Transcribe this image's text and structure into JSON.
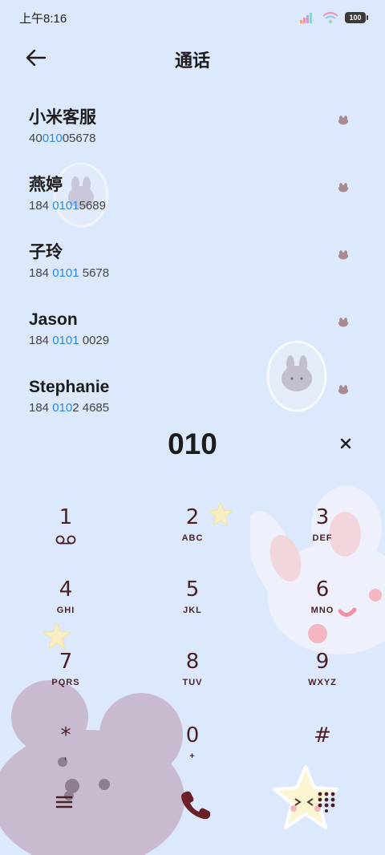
{
  "status_bar": {
    "time": "上午8:16",
    "battery": "100"
  },
  "header": {
    "title": "通话",
    "back_icon": "back-arrow-icon"
  },
  "contacts": [
    {
      "name": "小米客服",
      "number_pre": "40",
      "number_match": "010",
      "number_post": "05678"
    },
    {
      "name": "燕婷",
      "number_pre": "184 ",
      "number_match": "0101",
      "number_post": "5689"
    },
    {
      "name": "子玲",
      "number_pre": "184 ",
      "number_match": "0101",
      "number_post": " 5678"
    },
    {
      "name": "Jason",
      "number_pre": "184 ",
      "number_match": "0101",
      "number_post": " 0029"
    },
    {
      "name": "Stephanie",
      "number_pre": "184 ",
      "number_match": "010",
      "number_post": "2 4685"
    }
  ],
  "dial_input": {
    "value": "010",
    "delete_icon": "close-icon"
  },
  "keypad": [
    {
      "digit": "1",
      "letters": "",
      "icon": "voicemail-icon"
    },
    {
      "digit": "2",
      "letters": "ABC"
    },
    {
      "digit": "3",
      "letters": "DEF"
    },
    {
      "digit": "4",
      "letters": "GHI"
    },
    {
      "digit": "5",
      "letters": "JKL"
    },
    {
      "digit": "6",
      "letters": "MNO"
    },
    {
      "digit": "7",
      "letters": "PQRS"
    },
    {
      "digit": "8",
      "letters": "TUV"
    },
    {
      "digit": "9",
      "letters": "WXYZ"
    },
    {
      "digit": "*",
      "letters": ","
    },
    {
      "digit": "0",
      "letters": "+"
    },
    {
      "digit": "#",
      "letters": ""
    }
  ],
  "bottom_actions": {
    "menu_icon": "menu-icon",
    "call_icon": "phone-icon",
    "dialpad_icon": "dialpad-icon"
  },
  "colors": {
    "background": "#dce8fb",
    "highlight": "#2b8ae6",
    "key_text": "#4a1f26"
  }
}
